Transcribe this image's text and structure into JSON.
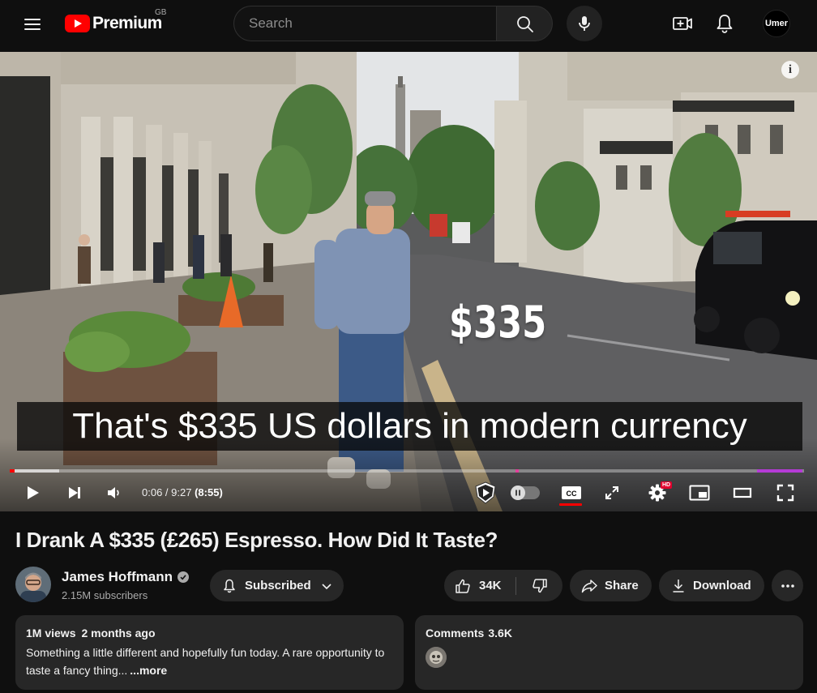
{
  "masthead": {
    "logo_text": "Premium",
    "region": "GB",
    "search_placeholder": "Search",
    "avatar_label": "Umer"
  },
  "player": {
    "overlay_price": "$335",
    "caption": "That's $335 US dollars in modern currency",
    "time_current": "0:06",
    "time_separator": " / ",
    "time_total": "9:27",
    "time_remaining": "(8:55)",
    "hd_badge": "HD",
    "progress_played_fraction": 0.006,
    "progress_loaded_fraction": 0.062,
    "info_label": "i"
  },
  "video": {
    "title": "I Drank A $335 (£265) Espresso. How Did It Taste?"
  },
  "channel": {
    "name": "James Hoffmann",
    "subscribers": "2.15M subscribers"
  },
  "actions": {
    "subscribe_label": "Subscribed",
    "like_count": "34K",
    "share_label": "Share",
    "download_label": "Download"
  },
  "description": {
    "views": "1M views",
    "age": "2 months ago",
    "text": "Something a little different and hopefully fun today. A rare opportunity to taste a fancy thing...",
    "more": "...more"
  },
  "comments": {
    "label": "Comments",
    "count": "3.6K"
  },
  "colors": {
    "brand_red": "#ff0000",
    "background": "#0f0f0f",
    "chip": "#272727",
    "sponsor_segment": "#b53bd6"
  }
}
